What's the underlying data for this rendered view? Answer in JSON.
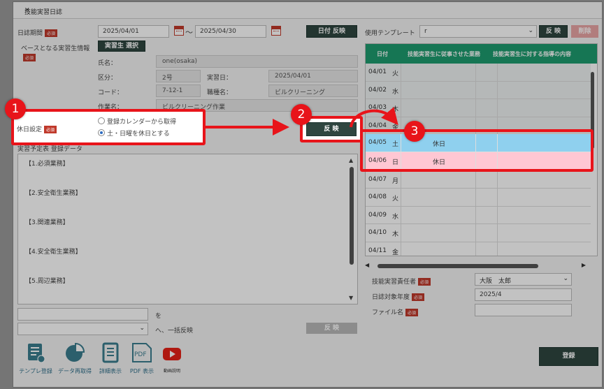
{
  "dialog": {
    "title": "技能実習日誌"
  },
  "period": {
    "label": "日誌期間",
    "required": "必須",
    "from": "2025/04/01",
    "tilde": "〜",
    "to": "2025/04/30",
    "apply_button": "日付 反映"
  },
  "base_trainee": {
    "label": "ベースとなる実習生情報",
    "required": "必須",
    "select_button": "実習生 選択"
  },
  "trainee": {
    "name_label": "氏名：",
    "name_value": "one(osaka)",
    "class_label": "区分：",
    "class_value": "2号",
    "date_label": "実習日：",
    "date_value": "2025/04/01",
    "code_label": "コード：",
    "code_value": "7-12-1",
    "job_label": "職種名：",
    "job_value": "ビルクリーニング",
    "work_label": "作業名：",
    "work_value": "ビルクリーニング作業"
  },
  "holiday": {
    "label": "休日設定",
    "required": "必須",
    "option1": "登録カレンダーから取得",
    "option2": "土・日曜を休日とする",
    "apply_button": "反 映"
  },
  "plan": {
    "label": "実習予定表 登録データ",
    "lines": [
      "【1.必須業務】",
      "【2.安全衛生業務】",
      "【3.関連業務】",
      "【4.安全衛生業務】",
      "【5.周辺業務】"
    ],
    "replace_suffix": "を",
    "bulk_suffix": "へ、一括反映",
    "bulk_button": "反 映"
  },
  "template": {
    "label": "使用テンプレート",
    "value": "r",
    "apply_button": "反 映",
    "delete_button": "削除"
  },
  "grid": {
    "col_date": "日付",
    "col_work": "技能実習生に従事させた業務",
    "col_guidance": "技能実習生に対する指導の内容",
    "rows": [
      {
        "date": "04/01",
        "dow": "火",
        "note": "",
        "state": "normal"
      },
      {
        "date": "04/02",
        "dow": "水",
        "note": "",
        "state": "normal"
      },
      {
        "date": "04/03",
        "dow": "木",
        "note": "",
        "state": "normal"
      },
      {
        "date": "04/04",
        "dow": "金",
        "note": "",
        "state": "normal"
      },
      {
        "date": "04/05",
        "dow": "土",
        "note": "休日",
        "state": "saturday"
      },
      {
        "date": "04/06",
        "dow": "日",
        "note": "休日",
        "state": "sunday"
      },
      {
        "date": "04/07",
        "dow": "月",
        "note": "",
        "state": "normal"
      },
      {
        "date": "04/08",
        "dow": "火",
        "note": "",
        "state": "normal"
      },
      {
        "date": "04/09",
        "dow": "水",
        "note": "",
        "state": "normal"
      },
      {
        "date": "04/10",
        "dow": "木",
        "note": "",
        "state": "normal"
      },
      {
        "date": "04/11",
        "dow": "金",
        "note": "",
        "state": "normal"
      }
    ]
  },
  "footer_fields": {
    "manager_label": "技能実習責任者",
    "manager_value": "大阪　太郎",
    "year_label": "日誌対象年度",
    "year_value": "2025/4",
    "file_label": "ファイル名",
    "required": "必須",
    "register_button": "登録"
  },
  "tools": [
    {
      "label": "テンプレ登録",
      "icon": "template-register-icon"
    },
    {
      "label": "データ再取得",
      "icon": "pie-chart-icon"
    },
    {
      "label": "詳細表示",
      "icon": "document-icon"
    },
    {
      "label": "PDF 表示",
      "icon": "pdf-icon"
    },
    {
      "label": "動画説明",
      "icon": "youtube-icon"
    }
  ],
  "annotations": {
    "b1": "1",
    "b2": "2",
    "b3": "3"
  },
  "colors": {
    "accent_green": "#1e9c6f",
    "dark_button": "#2f4640",
    "highlight_red": "#e8141a",
    "saturday_row": "#8fd0ee",
    "sunday_row": "#ffc7d3"
  }
}
